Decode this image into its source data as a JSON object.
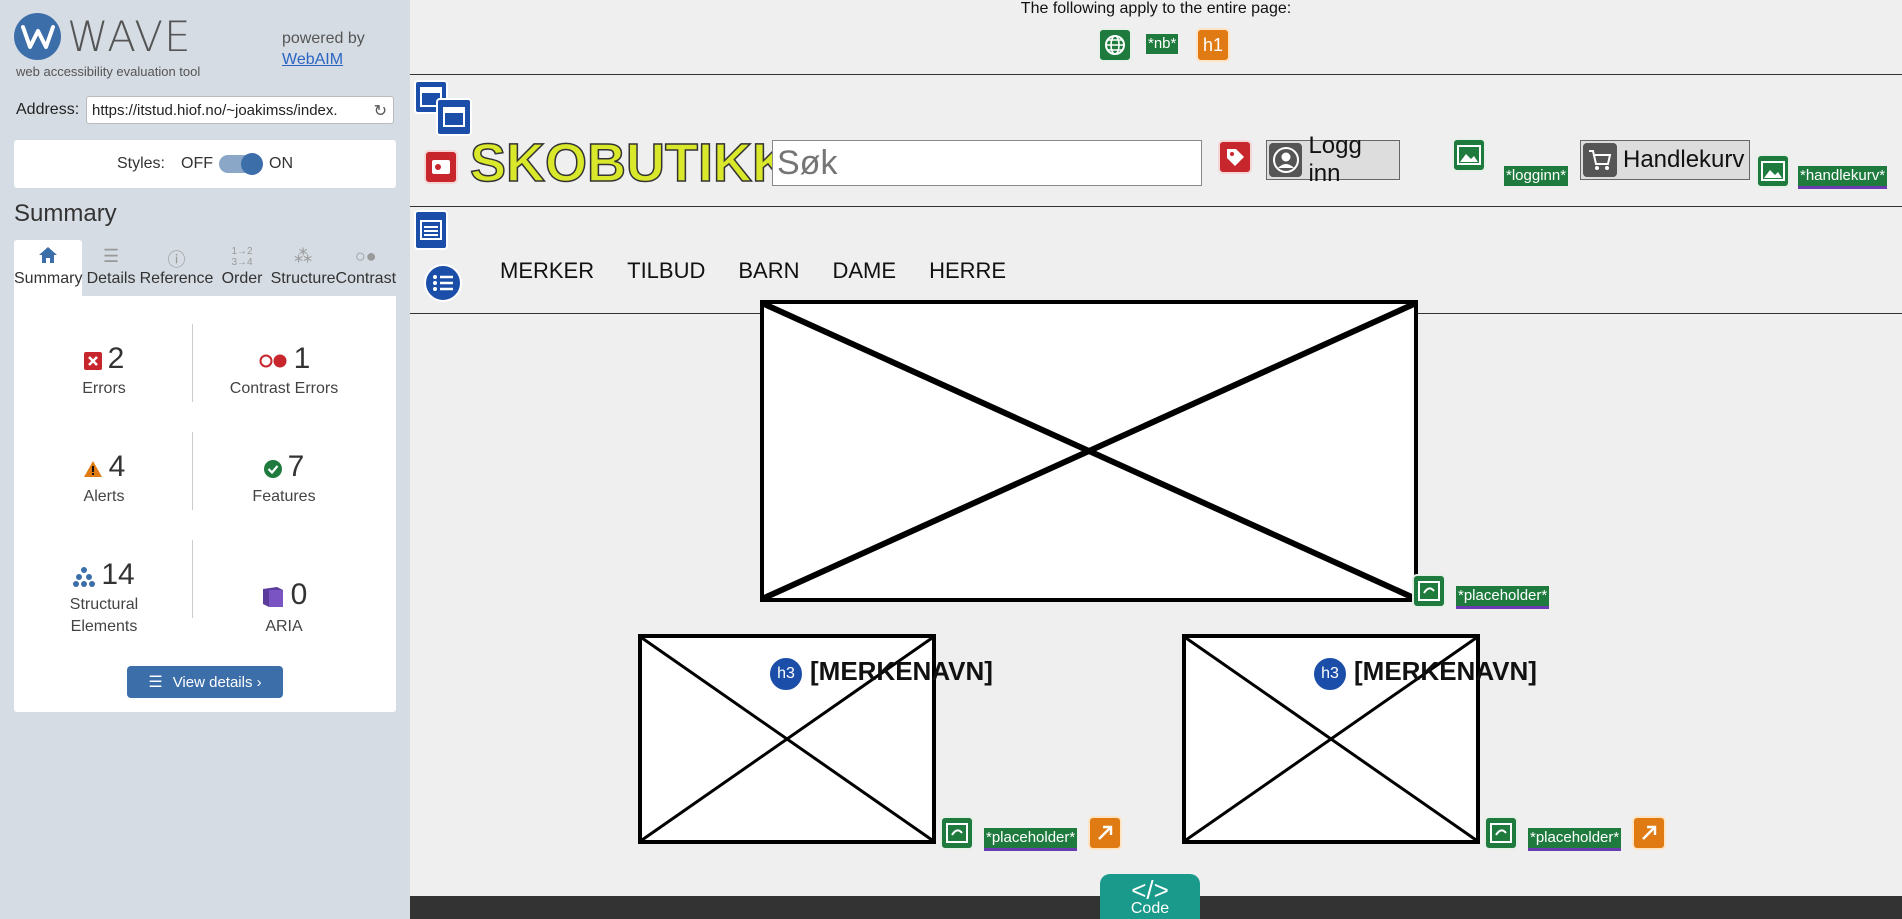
{
  "wave": {
    "logo_text": "WAVE",
    "tagline": "web accessibility evaluation tool",
    "powered_by": "powered by",
    "webaim_link": "WebAIM",
    "address_label": "Address:",
    "address_value": "https://itstud.hiof.no/~joakimss/index.",
    "styles_label": "Styles:",
    "styles_off": "OFF",
    "styles_on": "ON",
    "summary_title": "Summary",
    "tabs": [
      {
        "label": "Summary",
        "icon": "home-icon"
      },
      {
        "label": "Details",
        "icon": "list-icon"
      },
      {
        "label": "Reference",
        "icon": "info-icon"
      },
      {
        "label": "Order",
        "icon": "order-icon"
      },
      {
        "label": "Structure",
        "icon": "structure-icon"
      },
      {
        "label": "Contrast",
        "icon": "contrast-icon"
      }
    ],
    "stats": {
      "errors": {
        "count": "2",
        "label": "Errors"
      },
      "contrast_errors": {
        "count": "1",
        "label": "Contrast Errors"
      },
      "alerts": {
        "count": "4",
        "label": "Alerts"
      },
      "features": {
        "count": "7",
        "label": "Features"
      },
      "structural": {
        "count": "14",
        "label": "Structural Elements"
      },
      "aria": {
        "count": "0",
        "label": "ARIA"
      }
    },
    "view_details": "View details ›",
    "colors": {
      "accent": "#3c6ea9",
      "error": "#c8262d",
      "alert": "#e07b14",
      "feature": "#1f7a3e",
      "aria": "#5b3b9c"
    }
  },
  "page": {
    "top_note": "The following apply to the entire page:",
    "lang_tag": "*nb*",
    "h1_label": "h1",
    "brand": "SKOBUTIKK",
    "search_placeholder": "Søk",
    "login_label": "Logg inn",
    "logginn_tag": "*logginn*",
    "cart_label": "Handlekurv",
    "handlekurv_tag": "*handlekurv*",
    "nav": [
      "MERKER",
      "TILBUD",
      "BARN",
      "DAME",
      "HERRE"
    ],
    "placeholder_tag": "*placeholder*",
    "h3_badge": "h3",
    "brand_heading": "[MERKENAVN]",
    "code_tab": "Code",
    "code_symbol": "</>"
  }
}
